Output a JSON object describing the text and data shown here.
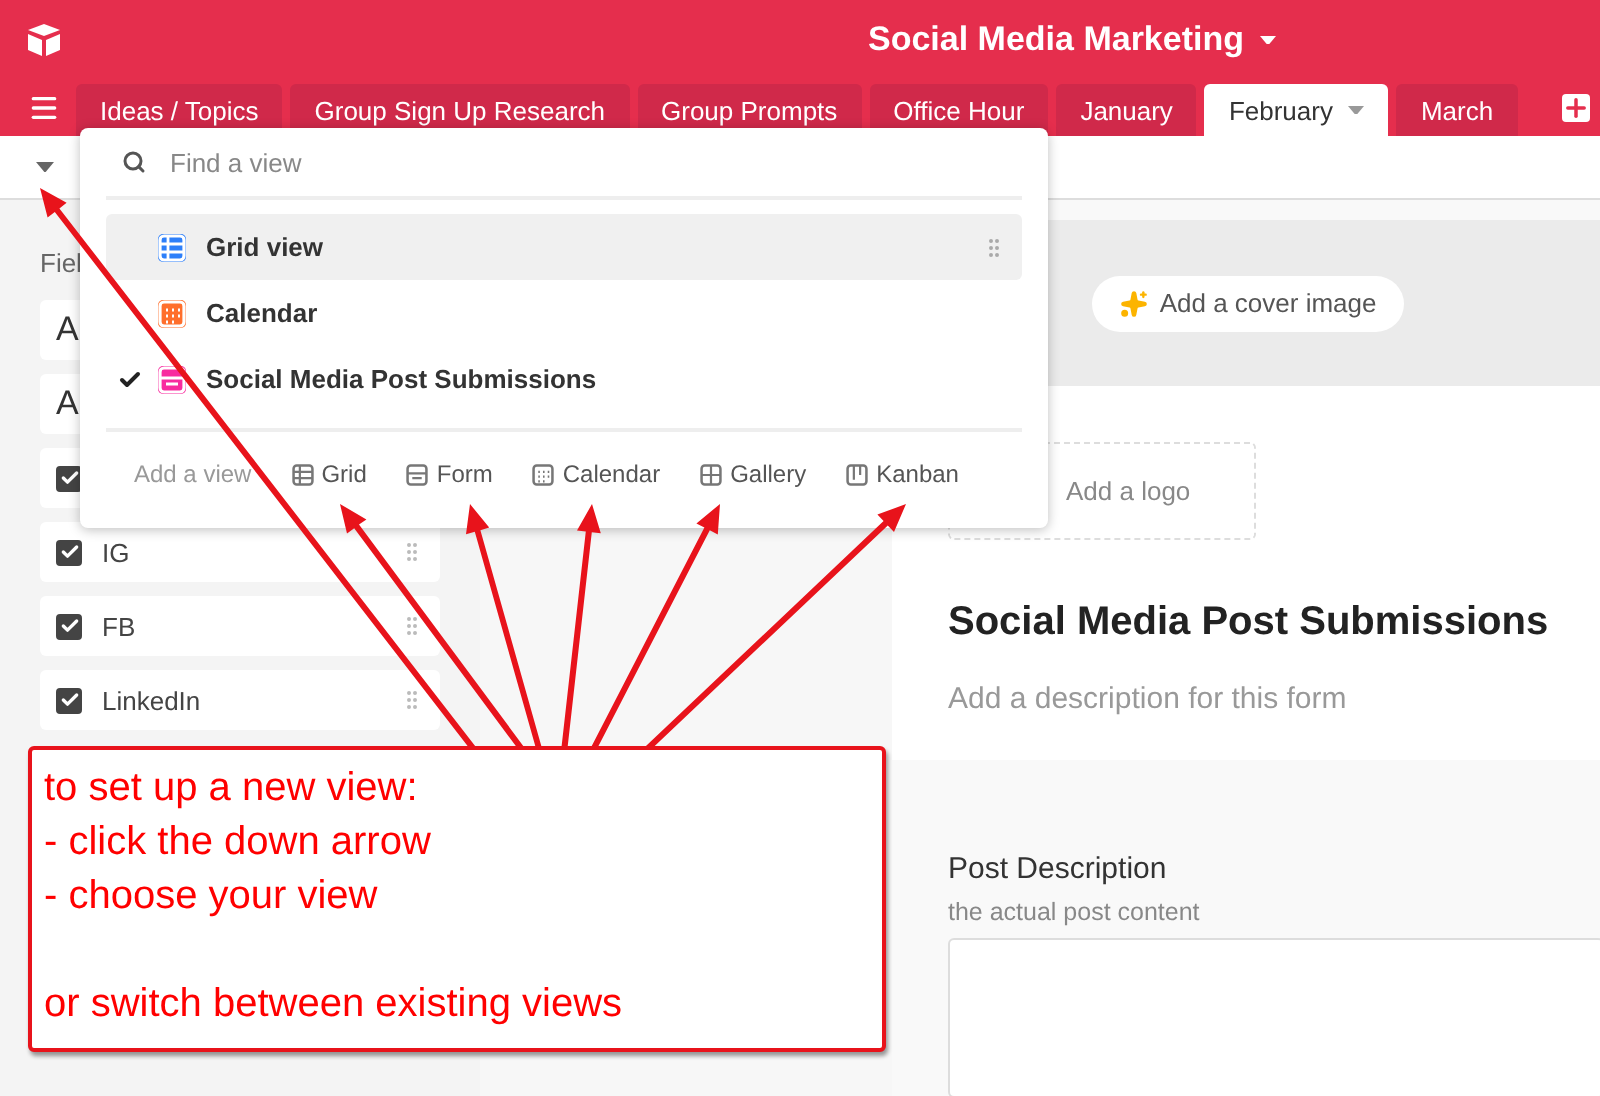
{
  "header": {
    "title": "Social Media Marketing"
  },
  "tabs": [
    {
      "label": "Ideas / Topics",
      "selected": false
    },
    {
      "label": "Group Sign Up Research",
      "selected": false
    },
    {
      "label": "Group Prompts",
      "selected": false
    },
    {
      "label": "Office Hour",
      "selected": false
    },
    {
      "label": "January",
      "selected": false
    },
    {
      "label": "February",
      "selected": true
    },
    {
      "label": "March",
      "selected": false
    }
  ],
  "sidebar": {
    "heading": "Fiel",
    "fields": [
      {
        "kind": "text",
        "label": "A"
      },
      {
        "kind": "text",
        "label": "A"
      },
      {
        "kind": "checkbox",
        "checked": true
      },
      {
        "kind": "checkbox",
        "checked": true,
        "label": "IG"
      },
      {
        "kind": "checkbox",
        "checked": true,
        "label": "FB"
      },
      {
        "kind": "checkbox",
        "checked": true,
        "label": "LinkedIn"
      }
    ]
  },
  "view_menu": {
    "search": {
      "placeholder": "Find a view"
    },
    "views": [
      {
        "label": "Grid view",
        "kind": "grid",
        "color": "#2d7ff9",
        "highlighted": true,
        "selected": false
      },
      {
        "label": "Calendar",
        "kind": "calendar",
        "color": "#ff6f2c",
        "highlighted": false,
        "selected": false
      },
      {
        "label": "Social Media Post Submissions",
        "kind": "form",
        "color": "#f82b9f",
        "highlighted": false,
        "selected": true
      }
    ],
    "add_view": {
      "label": "Add a view",
      "options": [
        {
          "label": "Grid",
          "kind": "grid"
        },
        {
          "label": "Form",
          "kind": "form"
        },
        {
          "label": "Calendar",
          "kind": "calendar"
        },
        {
          "label": "Gallery",
          "kind": "gallery"
        },
        {
          "label": "Kanban",
          "kind": "kanban"
        }
      ]
    }
  },
  "form": {
    "cover_button": "Add a cover image",
    "logo_button": "Add a logo",
    "title": "Social Media Post Submissions",
    "description": {
      "placeholder": "Add a description for this form"
    },
    "fields": [
      {
        "label": "Post Description",
        "help": "the actual post content"
      }
    ]
  },
  "callout": {
    "steps": [
      "to set up a new view:",
      "- click the down arrow",
      "- choose your view"
    ],
    "footer": "or switch between existing views"
  }
}
